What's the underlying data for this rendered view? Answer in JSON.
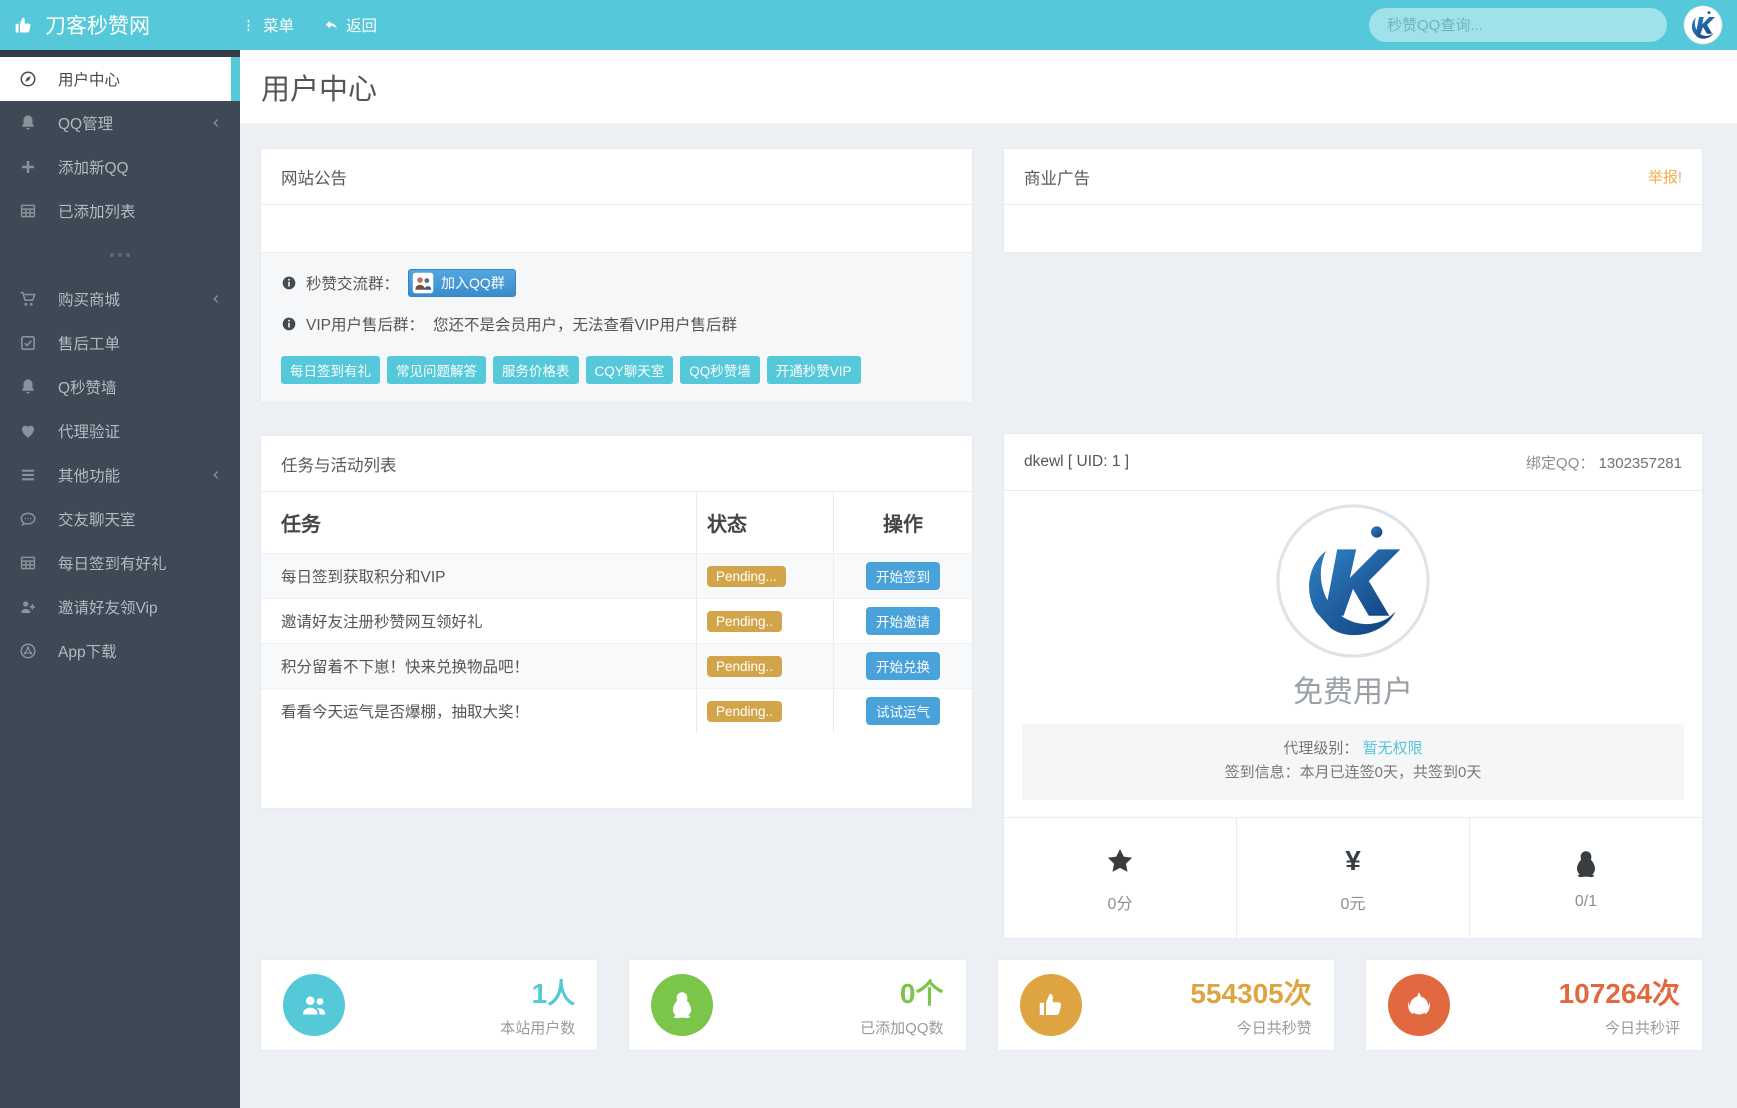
{
  "header": {
    "brand": "刀客秒赞网",
    "menu_label": "菜单",
    "back_label": "返回",
    "search_placeholder": "秒赞QQ查询...",
    "logo_icon": "k-logo"
  },
  "colors": {
    "accent_teal": "#55c8d9",
    "sidebar_dark": "#3d4954",
    "badge_orange": "#d2a54b",
    "action_blue": "#4aa2da",
    "report_orange": "#f0ad4e",
    "link_teal": "#56c5d8"
  },
  "page_title": "用户中心",
  "sidebar": {
    "items": [
      {
        "label": "用户中心",
        "icon": "compass",
        "active": true
      },
      {
        "label": "QQ管理",
        "icon": "bell",
        "chevron": true
      },
      {
        "label": "添加新QQ",
        "icon": "plus"
      },
      {
        "label": "已添加列表",
        "icon": "table"
      },
      {
        "divider": true
      },
      {
        "label": "购买商城",
        "icon": "cart",
        "chevron": true
      },
      {
        "label": "售后工单",
        "icon": "check-square"
      },
      {
        "label": "Q秒赞墙",
        "icon": "bell"
      },
      {
        "label": "代理验证",
        "icon": "heart"
      },
      {
        "label": "其他功能",
        "icon": "list",
        "chevron": true
      },
      {
        "label": "交友聊天室",
        "icon": "comment"
      },
      {
        "label": "每日签到有好礼",
        "icon": "table"
      },
      {
        "label": "邀请好友领Vip",
        "icon": "user-plus"
      },
      {
        "label": "App下载",
        "icon": "share"
      }
    ]
  },
  "announcement": {
    "title": "网站公告",
    "group_label": "秒赞交流群：",
    "join_button": "加入QQ群",
    "vip_label": "VIP用户售后群：",
    "vip_text": "您还不是会员用户，无法查看VIP用户售后群",
    "quick_links": [
      "每日签到有礼",
      "常见问题解答",
      "服务价格表",
      "CQY聊天室",
      "QQ秒赞墙",
      "开通秒赞VIP"
    ]
  },
  "ad_panel": {
    "title": "商业广告",
    "report_link": "举报!"
  },
  "tasks": {
    "title": "任务与活动列表",
    "columns": [
      "任务",
      "状态",
      "操作"
    ],
    "rows": [
      {
        "task": "每日签到获取积分和VIP",
        "status": "Pending...",
        "action": "开始签到"
      },
      {
        "task": "邀请好友注册秒赞网互领好礼",
        "status": "Pending..",
        "action": "开始邀请"
      },
      {
        "task": "积分留着不下崽！快来兑换物品吧！",
        "status": "Pending..",
        "action": "开始兑换"
      },
      {
        "task": "看看今天运气是否爆棚，抽取大奖！",
        "status": "Pending..",
        "action": "试试运气"
      }
    ]
  },
  "profile": {
    "username": "dkewl [ UID: 1 ]",
    "bind_qq_label": "绑定QQ：",
    "bind_qq_value": "1302357281",
    "avatar_icon": "k-logo",
    "user_type": "免费用户",
    "agent_label": "代理级别：",
    "agent_value": "暂无权限",
    "signin_info": "签到信息：本月已连签0天，共签到0天",
    "stats": [
      {
        "icon": "star",
        "value": "0分"
      },
      {
        "icon": "yen",
        "value": "0元"
      },
      {
        "icon": "penguin",
        "value": "0/1"
      }
    ]
  },
  "summary_cards": [
    {
      "icon": "users",
      "value": "1人",
      "label": "本站用户数",
      "color": "#56c9d8"
    },
    {
      "icon": "penguin",
      "value": "0个",
      "label": "已添加QQ数",
      "color": "#7cc54b"
    },
    {
      "icon": "thumbs-up",
      "value": "554305次",
      "label": "今日共秒赞",
      "color": "#dfa442"
    },
    {
      "icon": "rebel",
      "value": "107264次",
      "label": "今日共秒评",
      "color": "#e2683f"
    }
  ]
}
